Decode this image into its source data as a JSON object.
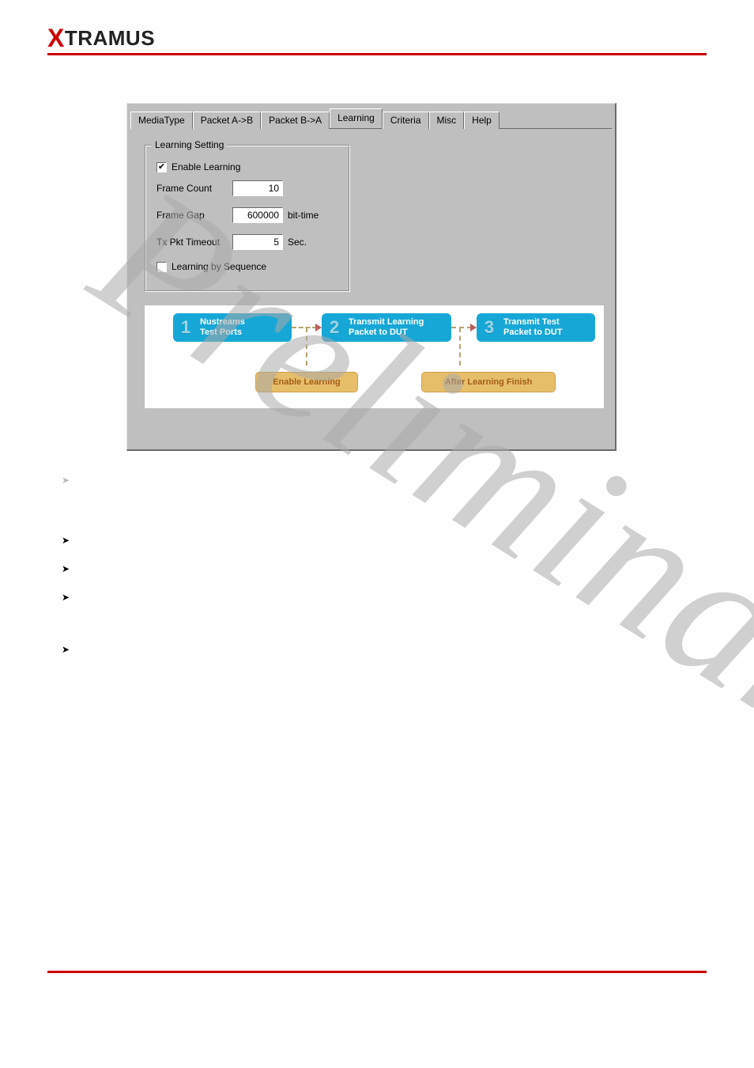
{
  "brand": {
    "x": "X",
    "rest": "TRAMUS"
  },
  "tabs": [
    "MediaType",
    "Packet A->B",
    "Packet B->A",
    "Learning",
    "Criteria",
    "Misc",
    "Help"
  ],
  "selected_tab": "Learning",
  "groupbox": {
    "legend": "Learning Setting",
    "enable_label": "Enable Learning",
    "enable_checked": true,
    "frame_count_label": "Frame Count",
    "frame_count_value": "10",
    "frame_gap_label": "Frame Gap",
    "frame_gap_value": "600000",
    "frame_gap_unit": "bit-time",
    "tx_pkt_label": "Tx Pkt Timeout",
    "tx_pkt_value": "5",
    "tx_pkt_unit": "Sec.",
    "seq_label": "Learning by Sequence",
    "seq_checked": false
  },
  "diagram": {
    "step1_num": "1",
    "step1_t1": "Nustreams",
    "step1_t2": "Test Ports",
    "step2_num": "2",
    "step2_t1": "Transmit Learning",
    "step2_t2": "Packet to DUT",
    "step3_num": "3",
    "step3_t1": "Transmit Test",
    "step3_t2": "Packet to DUT",
    "enable_label": "Enable Learning",
    "after_label": "After Learning Finish"
  },
  "watermark": "Preliminary"
}
